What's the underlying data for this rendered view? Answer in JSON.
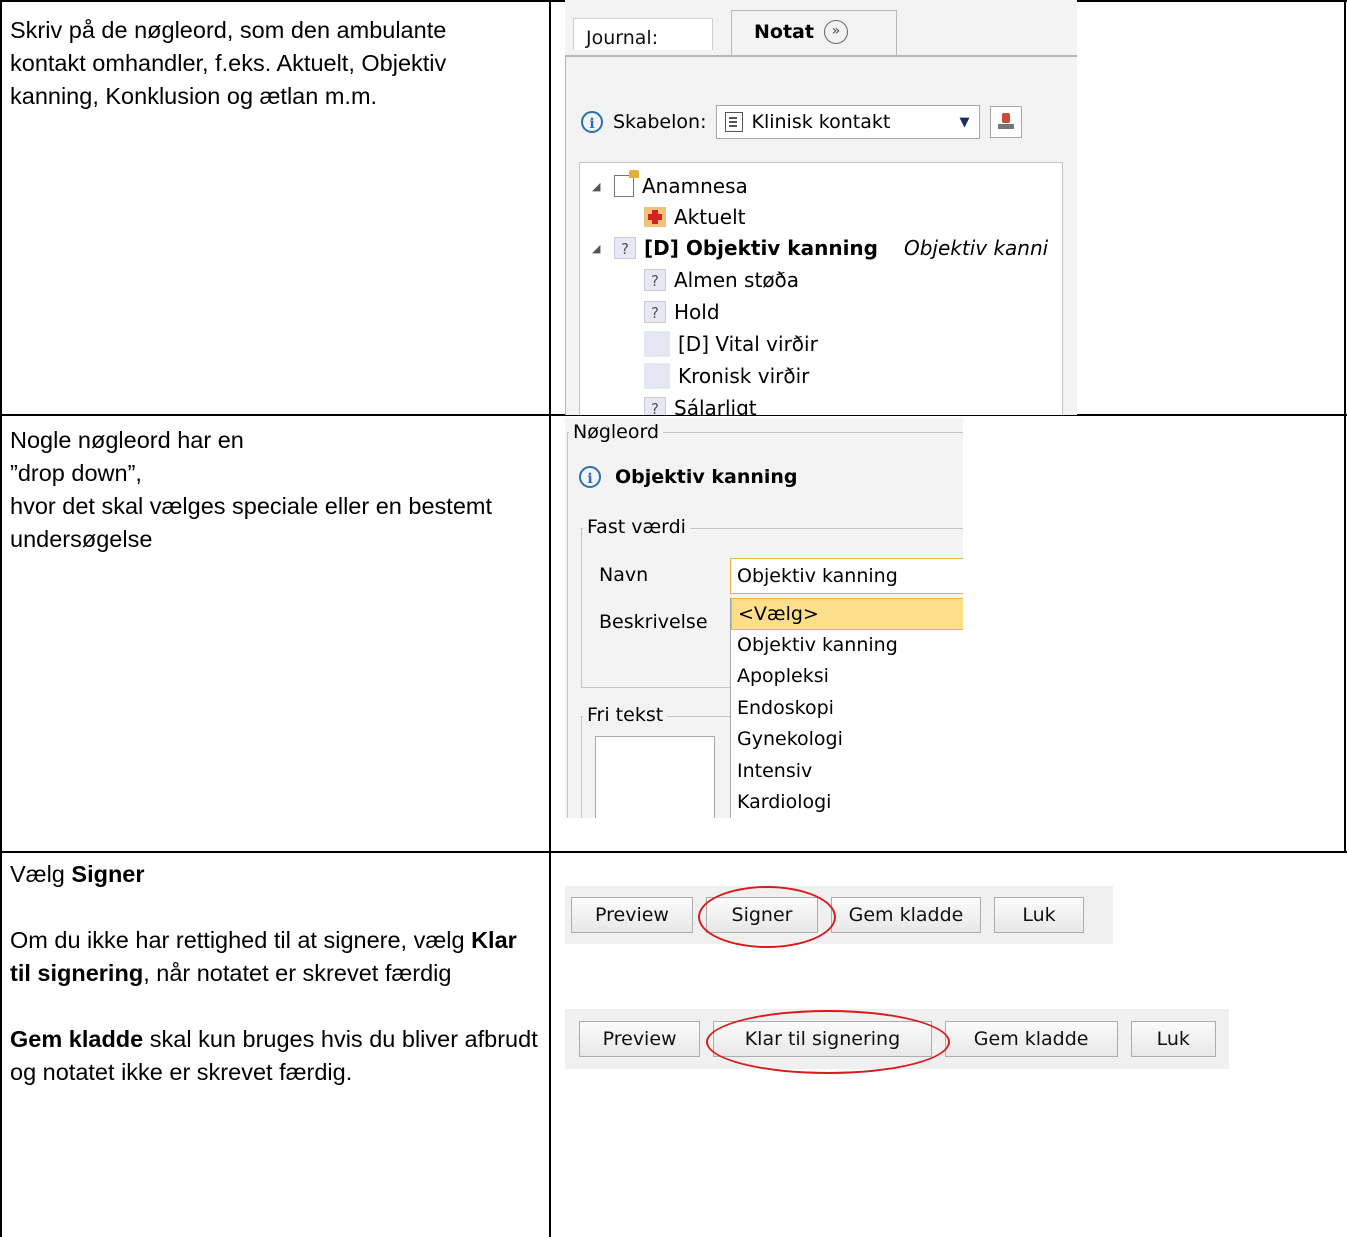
{
  "rows": [
    {
      "paragraphs": [
        "Skriv på de nøgleord, som den ambulante kontakt omhandler, f.eks. Aktuelt, Objektiv kanning, Konklusion og ætlan m.m."
      ]
    },
    {
      "paragraphs": [
        "Nogle nøgleord har en",
        "”drop down”,",
        "hvor det skal vælges speciale eller en bestemt undersøgelse"
      ]
    },
    {
      "heading_prefix": "Vælg ",
      "heading_bold": "Signer",
      "p2_prefix": "Om du ikke har rettighed til at signere, vælg ",
      "p2_bold": "Klar til signering",
      "p2_suffix": ", når notatet er skrevet færdig",
      "p3_bold": "Gem kladde",
      "p3_suffix": " skal kun bruges hvis du bliver afbrudt og notatet ikke er skrevet færdig."
    }
  ],
  "note_panel": {
    "tabs": [
      "Journal:",
      "Notat"
    ],
    "template_label": "Skabelon:",
    "template_value": "Klinisk kontakt",
    "tree": [
      {
        "label": "Anamnesa",
        "icon": "locked-document-icon",
        "level": 0,
        "expanded": true
      },
      {
        "label": "Aktuelt",
        "icon": "first-aid-icon",
        "level": 1
      },
      {
        "label": "[D] Objektiv kanning",
        "hint": "Objektiv kanni",
        "icon": "question-icon",
        "level": 0,
        "expanded": true,
        "bold": true
      },
      {
        "label": "Almen støða",
        "icon": "question-icon",
        "level": 1
      },
      {
        "label": "Hold",
        "icon": "question-icon",
        "level": 1
      },
      {
        "label": "[D] Vital virðir",
        "icon": "blank-icon",
        "level": 1
      },
      {
        "label": "Kronisk virðir",
        "icon": "blank-icon",
        "level": 1
      },
      {
        "label": "Sálarligt",
        "icon": "question-icon",
        "level": 1
      }
    ]
  },
  "keyword_panel": {
    "group_label": "Nøgleord",
    "title": "Objektiv kanning",
    "fixed_value_label": "Fast værdi",
    "name_label": "Navn",
    "name_value": "Objektiv kanning",
    "description_label": "Beskrivelse",
    "free_text_label": "Fri tekst",
    "options": [
      "<Vælg>",
      "Objektiv kanning",
      "Apopleksi",
      "Endoskopi",
      "Gynekologi",
      "Intensiv",
      "Kardiologi"
    ],
    "selected_option": "<Vælg>"
  },
  "button_bar_1": {
    "buttons": [
      "Preview",
      "Signer",
      "Gem kladde",
      "Luk"
    ],
    "highlighted": "Signer"
  },
  "button_bar_2": {
    "buttons": [
      "Preview",
      "Klar til signering",
      "Gem kladde",
      "Luk"
    ],
    "highlighted": "Klar til signering"
  },
  "colors": {
    "highlight_ellipse": "#d81b1b",
    "selected_option_bg": "#fddf8b",
    "info_icon": "#2a6fb0"
  }
}
